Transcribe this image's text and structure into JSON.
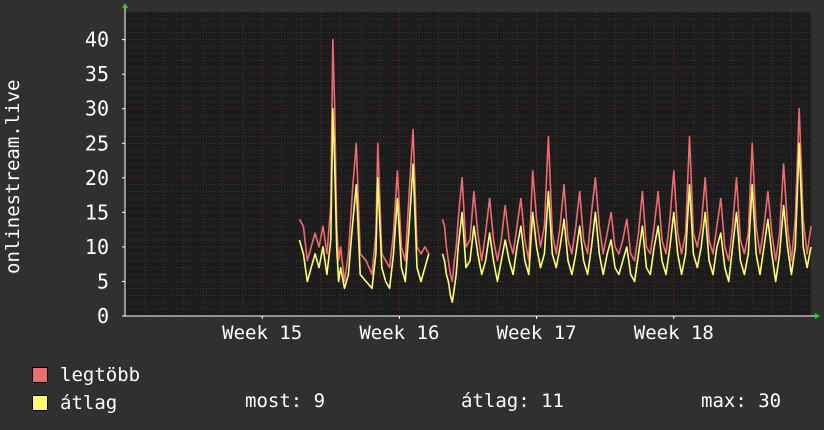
{
  "ylabel": "onlinestream.live",
  "legend": {
    "max_label": "legtöbb",
    "avg_label": "átlag",
    "now_text": "most: 9",
    "avg_text": "átlag: 11",
    "max_text": "max: 30"
  },
  "colors": {
    "background": "#303030",
    "plot": "#1c1c1c",
    "max_series": "#f06b71",
    "avg_series": "#ffff70",
    "grid_major": "#6e2222",
    "axis": "#ffffff"
  },
  "chart_data": {
    "type": "line",
    "ylim": [
      0,
      44
    ],
    "yticks": [
      0,
      5,
      10,
      15,
      20,
      25,
      30,
      35,
      40
    ],
    "xlim": [
      0,
      35
    ],
    "xticks": [
      {
        "label": "Week 15",
        "x": 7
      },
      {
        "label": "Week 16",
        "x": 14
      },
      {
        "label": "Week 17",
        "x": 21
      },
      {
        "label": "Week 18",
        "x": 28
      }
    ],
    "grid": true,
    "series": [
      {
        "name": "legtöbb",
        "color": "#f06b71",
        "segments": [
          {
            "x": [
              8.9,
              9.1,
              9.3,
              9.5,
              9.7,
              9.9,
              10.1,
              10.3,
              10.5,
              10.6,
              10.7,
              10.8,
              10.9,
              11.0,
              11.2,
              11.4,
              11.6,
              11.8,
              12.0,
              12.3,
              12.6,
              12.8,
              12.9,
              13.1,
              13.3,
              13.5,
              13.7,
              13.9,
              14.1,
              14.3,
              14.5,
              14.7,
              14.9,
              15.1,
              15.3,
              15.5
            ],
            "y": [
              14,
              13,
              8,
              10,
              12,
              10,
              13,
              9,
              16,
              40,
              30,
              13,
              8,
              10,
              5,
              9,
              18,
              25,
              9,
              8,
              6,
              12,
              25,
              9,
              8,
              7,
              12,
              21,
              10,
              8,
              18,
              27,
              10,
              9,
              10,
              9
            ]
          },
          {
            "x": [
              16.2,
              16.3,
              16.4,
              16.5,
              16.6,
              16.7,
              16.8,
              16.9,
              17.0,
              17.2,
              17.4,
              17.6,
              17.8,
              18.0,
              18.2,
              18.4,
              18.6,
              18.8,
              19.0,
              19.2,
              19.4,
              19.6,
              19.8,
              20.0,
              20.2,
              20.4,
              20.6,
              20.8,
              21.0,
              21.2,
              21.4,
              21.6,
              21.8,
              22.0,
              22.2,
              22.4,
              22.6,
              22.8,
              23.0,
              23.2,
              23.4,
              23.6,
              23.8,
              24.0,
              24.2,
              24.4,
              24.6,
              24.8,
              25.0,
              25.2,
              25.4,
              25.6,
              25.8,
              26.0,
              26.2,
              26.4,
              26.6,
              26.8,
              27.0,
              27.2,
              27.4,
              27.6,
              27.8,
              28.0,
              28.2,
              28.4,
              28.6,
              28.8,
              29.0,
              29.2,
              29.4,
              29.6,
              29.8,
              30.0,
              30.2,
              30.4,
              30.6,
              30.8,
              31.0,
              31.2,
              31.4,
              31.6,
              31.8,
              32.0,
              32.2,
              32.4,
              32.6,
              32.8,
              33.0,
              33.2,
              33.4,
              33.6,
              33.8,
              34.0,
              34.2,
              34.4,
              34.6,
              34.8,
              35.0
            ],
            "y": [
              14,
              13,
              10,
              8,
              6,
              5,
              8,
              10,
              14,
              20,
              10,
              11,
              18,
              12,
              8,
              12,
              17,
              11,
              8,
              11,
              16,
              11,
              9,
              13,
              17,
              11,
              8,
              21,
              14,
              10,
              13,
              26,
              12,
              9,
              13,
              19,
              11,
              9,
              13,
              18,
              11,
              9,
              15,
              20,
              13,
              9,
              12,
              15,
              10,
              9,
              11,
              14,
              9,
              8,
              12,
              18,
              10,
              9,
              13,
              18,
              11,
              9,
              14,
              21,
              12,
              9,
              12,
              26,
              12,
              10,
              13,
              20,
              11,
              9,
              13,
              17,
              10,
              8,
              13,
              20,
              11,
              9,
              12,
              25,
              13,
              9,
              13,
              18,
              12,
              8,
              12,
              22,
              13,
              8,
              14,
              30,
              14,
              9,
              13,
              19,
              11,
              13,
              9
            ]
          }
        ]
      },
      {
        "name": "átlag",
        "color": "#ffff70",
        "segments": [
          {
            "x": [
              8.9,
              9.1,
              9.3,
              9.5,
              9.7,
              9.9,
              10.1,
              10.3,
              10.5,
              10.6,
              10.7,
              10.8,
              10.9,
              11.0,
              11.2,
              11.4,
              11.6,
              11.8,
              12.0,
              12.3,
              12.6,
              12.8,
              12.9,
              13.1,
              13.3,
              13.5,
              13.7,
              13.9,
              14.1,
              14.3,
              14.5,
              14.7,
              14.9,
              15.1,
              15.3,
              15.5
            ],
            "y": [
              11,
              9,
              5,
              7,
              9,
              7,
              10,
              6,
              11,
              30,
              22,
              10,
              5,
              7,
              4,
              6,
              13,
              19,
              6,
              5,
              4,
              9,
              20,
              7,
              5,
              4,
              9,
              17,
              7,
              5,
              13,
              22,
              7,
              5,
              7,
              9
            ]
          },
          {
            "x": [
              16.2,
              16.3,
              16.4,
              16.5,
              16.6,
              16.7,
              16.8,
              16.9,
              17.0,
              17.2,
              17.4,
              17.6,
              17.8,
              18.0,
              18.2,
              18.4,
              18.6,
              18.8,
              19.0,
              19.2,
              19.4,
              19.6,
              19.8,
              20.0,
              20.2,
              20.4,
              20.6,
              20.8,
              21.0,
              21.2,
              21.4,
              21.6,
              21.8,
              22.0,
              22.2,
              22.4,
              22.6,
              22.8,
              23.0,
              23.2,
              23.4,
              23.6,
              23.8,
              24.0,
              24.2,
              24.4,
              24.6,
              24.8,
              25.0,
              25.2,
              25.4,
              25.6,
              25.8,
              26.0,
              26.2,
              26.4,
              26.6,
              26.8,
              27.0,
              27.2,
              27.4,
              27.6,
              27.8,
              28.0,
              28.2,
              28.4,
              28.6,
              28.8,
              29.0,
              29.2,
              29.4,
              29.6,
              29.8,
              30.0,
              30.2,
              30.4,
              30.6,
              30.8,
              31.0,
              31.2,
              31.4,
              31.6,
              31.8,
              32.0,
              32.2,
              32.4,
              32.6,
              32.8,
              33.0,
              33.2,
              33.4,
              33.6,
              33.8,
              34.0,
              34.2,
              34.4,
              34.6,
              34.8,
              35.0
            ],
            "y": [
              9,
              8,
              6,
              5,
              3,
              2,
              4,
              6,
              10,
              15,
              7,
              8,
              13,
              9,
              6,
              8,
              12,
              8,
              5,
              8,
              11,
              8,
              6,
              10,
              13,
              8,
              6,
              15,
              10,
              7,
              9,
              18,
              9,
              7,
              10,
              14,
              8,
              6,
              9,
              13,
              8,
              6,
              10,
              15,
              9,
              6,
              9,
              11,
              7,
              6,
              8,
              10,
              6,
              5,
              9,
              13,
              7,
              6,
              10,
              13,
              8,
              6,
              10,
              15,
              9,
              6,
              9,
              19,
              9,
              7,
              10,
              15,
              8,
              6,
              10,
              12,
              7,
              5,
              10,
              15,
              8,
              6,
              9,
              19,
              9,
              6,
              10,
              14,
              9,
              5,
              9,
              16,
              10,
              6,
              10,
              25,
              10,
              7,
              10,
              14,
              8,
              10,
              9
            ]
          }
        ]
      }
    ]
  }
}
